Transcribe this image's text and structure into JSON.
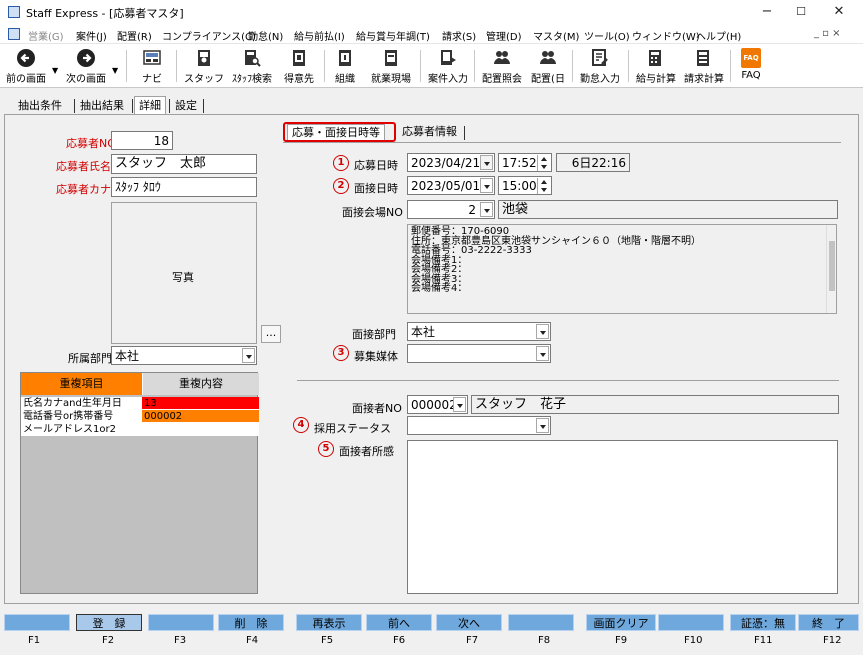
{
  "window": {
    "title": "Staff Express - [応募者マスタ]",
    "minimize": "−",
    "maximize": "☐",
    "close": "✕"
  },
  "menu": [
    {
      "label": "営業(G)",
      "disabled": true
    },
    {
      "label": "案件(J)",
      "disabled": false
    },
    {
      "label": "配置(R)",
      "disabled": false
    },
    {
      "label": "コンプライアンス(C)",
      "disabled": false
    },
    {
      "label": "勤怠(N)",
      "disabled": false
    },
    {
      "label": "給与前払(I)",
      "disabled": false
    },
    {
      "label": "給与賞与年調(T)",
      "disabled": false
    },
    {
      "label": "請求(S)",
      "disabled": false
    },
    {
      "label": "管理(D)",
      "disabled": false
    },
    {
      "label": "マスタ(M)",
      "disabled": false
    },
    {
      "label": "ツール(O)",
      "disabled": false
    },
    {
      "label": "ウィンドウ(W)",
      "disabled": false
    },
    {
      "label": "ヘルプ(H)",
      "disabled": false
    }
  ],
  "mdi_controls": "_ ▫ ×",
  "toolbar": {
    "prev": "前の画面",
    "next": "次の画面",
    "navi": "ナビ",
    "staff": "スタッフ",
    "staff_search": "ｽﾀｯﾌ検索",
    "client": "得意先",
    "org": "組織",
    "site": "就業現場",
    "case_input": "案件入力",
    "assign_view": "配置照会",
    "assign_day": "配置(日",
    "attendance": "勤怠入力",
    "payroll": "給与計算",
    "billing": "請求計算",
    "faq": "FAQ",
    "faq_logo": "FAQ"
  },
  "main_tabs": [
    "抽出条件",
    "抽出結果",
    "詳細",
    "設定"
  ],
  "left": {
    "applicant_no_label": "応募者NO",
    "applicant_no": "18",
    "name_label": "応募者氏名",
    "name": "スタッフ　太郎",
    "kana_label": "応募者カナ",
    "kana": "ｽﾀｯﾌ ﾀﾛｳ",
    "photo_label": "写真",
    "photo_button": "...",
    "dept_label": "所属部門",
    "dept": "本社",
    "dup_headers": [
      "重複項目",
      "重複内容"
    ],
    "dup_rows": [
      {
        "item": "氏名カナand生年月日",
        "value": "13",
        "color": "#ff0000"
      },
      {
        "item": "電話番号or携帯番号",
        "value": "000002",
        "color": "#ff8000"
      },
      {
        "item": "メールアドレス1or2",
        "value": "",
        "color": "#ffffff"
      }
    ]
  },
  "sub_tabs": [
    "応募・面接日時等",
    "応募者情報"
  ],
  "right": {
    "apply_num": "1",
    "apply_label": "応募日時",
    "apply_date": "2023/04/21",
    "apply_time": "17:52",
    "apply_elapsed": "6日22:16",
    "interview_num": "2",
    "interview_label": "面接日時",
    "interview_date": "2023/05/01",
    "interview_time": "15:00",
    "venue_label": "面接会場NO",
    "venue_no": "2",
    "venue_name": "池袋",
    "venue_details": [
      "郵便番号：170-6090",
      "住所：東京都豊島区東池袋サンシャイン６０（地階・階層不明）",
      "電話番号：03-2222-3333",
      "会場備考1：",
      "会場備考2：",
      "会場備考3：",
      "会場備考4："
    ],
    "interview_dept_label": "面接部門",
    "interview_dept": "本社",
    "media_num": "3",
    "media_label": "募集媒体",
    "media": "",
    "interviewer_label": "面接者NO",
    "interviewer_no": "000002",
    "interviewer_name": "スタッフ　花子",
    "status_num": "4",
    "status_label": "採用ステータス",
    "status": "",
    "impression_num": "5",
    "impression_label": "面接者所感",
    "impression": ""
  },
  "fkeys": [
    {
      "key": "F1",
      "label": ""
    },
    {
      "key": "F2",
      "label": "登　録"
    },
    {
      "key": "F3",
      "label": ""
    },
    {
      "key": "F4",
      "label": "削　除"
    },
    {
      "key": "F5",
      "label": "再表示"
    },
    {
      "key": "F6",
      "label": "前へ"
    },
    {
      "key": "F7",
      "label": "次へ"
    },
    {
      "key": "F8",
      "label": ""
    },
    {
      "key": "F9",
      "label": "画面クリア"
    },
    {
      "key": "F10",
      "label": ""
    },
    {
      "key": "F11",
      "label": "証憑：無"
    },
    {
      "key": "F12",
      "label": "終　了"
    }
  ],
  "colors": {
    "accent_red": "#d00000",
    "fkey_blue": "#6fa8dc",
    "dup_header": "#ff8000"
  }
}
